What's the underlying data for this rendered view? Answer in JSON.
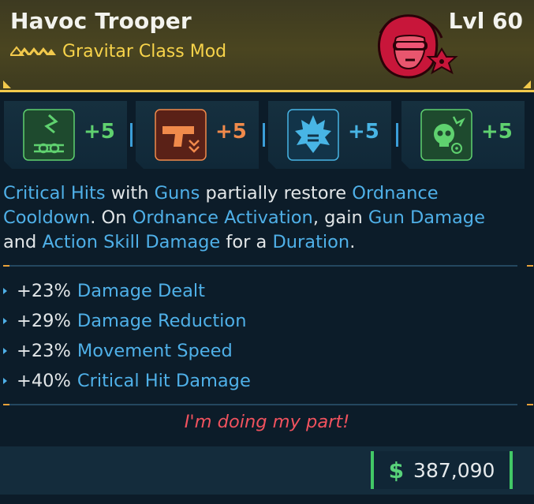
{
  "item": {
    "name": "Havoc Trooper",
    "level": "Lvl 60",
    "class_mod": "Gravitar Class Mod",
    "rarity_color": "#f2c94c"
  },
  "skills": [
    {
      "icon": "gravity-chevron-skill-icon",
      "bonus": "+5",
      "color": "#5fd16f",
      "tint": "green"
    },
    {
      "icon": "pistol-skill-icon",
      "bonus": "+5",
      "color": "#f08a4b",
      "tint": "orange"
    },
    {
      "icon": "shield-burst-skill-icon",
      "bonus": "+5",
      "color": "#48b5e5",
      "tint": "blue"
    },
    {
      "icon": "skull-radiation-skill-icon",
      "bonus": "+5",
      "color": "#5fd16f",
      "tint": "green"
    }
  ],
  "description": {
    "t1": "Critical Hits",
    "t2": " with ",
    "t3": "Guns",
    "t4": " partially restore ",
    "t5": "Ordnance Cooldown",
    "t6": ". On ",
    "t7": "Ordnance Activation",
    "t8": ", gain ",
    "t9": "Gun Damage",
    "t10": " and ",
    "t11": "Action Skill Damage",
    "t12": " for a ",
    "t13": "Duration",
    "t14": "."
  },
  "stats": [
    {
      "value": "+23%",
      "label": "Damage Dealt"
    },
    {
      "value": "+29%",
      "label": "Damage Reduction"
    },
    {
      "value": "+23%",
      "label": "Movement Speed"
    },
    {
      "value": "+40%",
      "label": "Critical Hit Damage"
    }
  ],
  "flavor": "I'm doing my part!",
  "price": {
    "currency_symbol": "$",
    "amount": "387,090"
  }
}
